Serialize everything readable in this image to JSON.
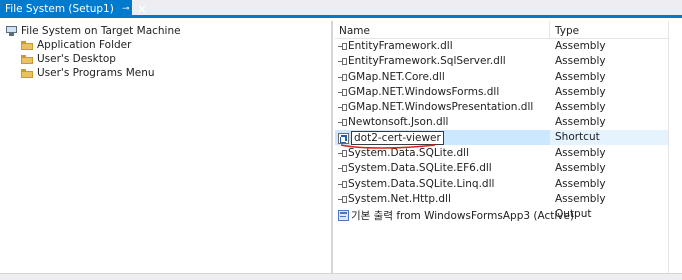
{
  "tab": {
    "title": "File System (Setup1)",
    "pin_icon": "pin-icon",
    "close_icon": "close-icon"
  },
  "tree": {
    "root_label": "File System on Target Machine",
    "root_icon": "computer-icon",
    "children": [
      {
        "label": "Application Folder",
        "icon": "folder-icon"
      },
      {
        "label": "User's Desktop",
        "icon": "folder-icon"
      },
      {
        "label": "User's Programs Menu",
        "icon": "folder-icon"
      }
    ]
  },
  "list": {
    "columns": {
      "name": "Name",
      "type": "Type"
    },
    "rows": [
      {
        "name": "EntityFramework.dll",
        "type": "Assembly",
        "icon": "reference-icon"
      },
      {
        "name": "EntityFramework.SqlServer.dll",
        "type": "Assembly",
        "icon": "reference-icon"
      },
      {
        "name": "GMap.NET.Core.dll",
        "type": "Assembly",
        "icon": "reference-icon"
      },
      {
        "name": "GMap.NET.WindowsForms.dll",
        "type": "Assembly",
        "icon": "reference-icon"
      },
      {
        "name": "GMap.NET.WindowsPresentation.dll",
        "type": "Assembly",
        "icon": "reference-icon"
      },
      {
        "name": "Newtonsoft.Json.dll",
        "type": "Assembly",
        "icon": "reference-icon"
      },
      {
        "name": "dot2-cert-viewer",
        "type": "Shortcut",
        "icon": "shortcut-icon",
        "selected": true,
        "editing": true
      },
      {
        "name": "System.Data.SQLite.dll",
        "type": "Assembly",
        "icon": "reference-icon"
      },
      {
        "name": "System.Data.SQLite.EF6.dll",
        "type": "Assembly",
        "icon": "reference-icon"
      },
      {
        "name": "System.Data.SQLite.Linq.dll",
        "type": "Assembly",
        "icon": "reference-icon"
      },
      {
        "name": "System.Net.Http.dll",
        "type": "Assembly",
        "icon": "reference-icon"
      },
      {
        "name": "기본 출력 from WindowsFormsApp3 (Active)",
        "type": "Output",
        "icon": "project-output-icon"
      }
    ]
  },
  "colors": {
    "accent": "#007acc",
    "selection": "#cce8ff",
    "annotation": "#e02020"
  }
}
